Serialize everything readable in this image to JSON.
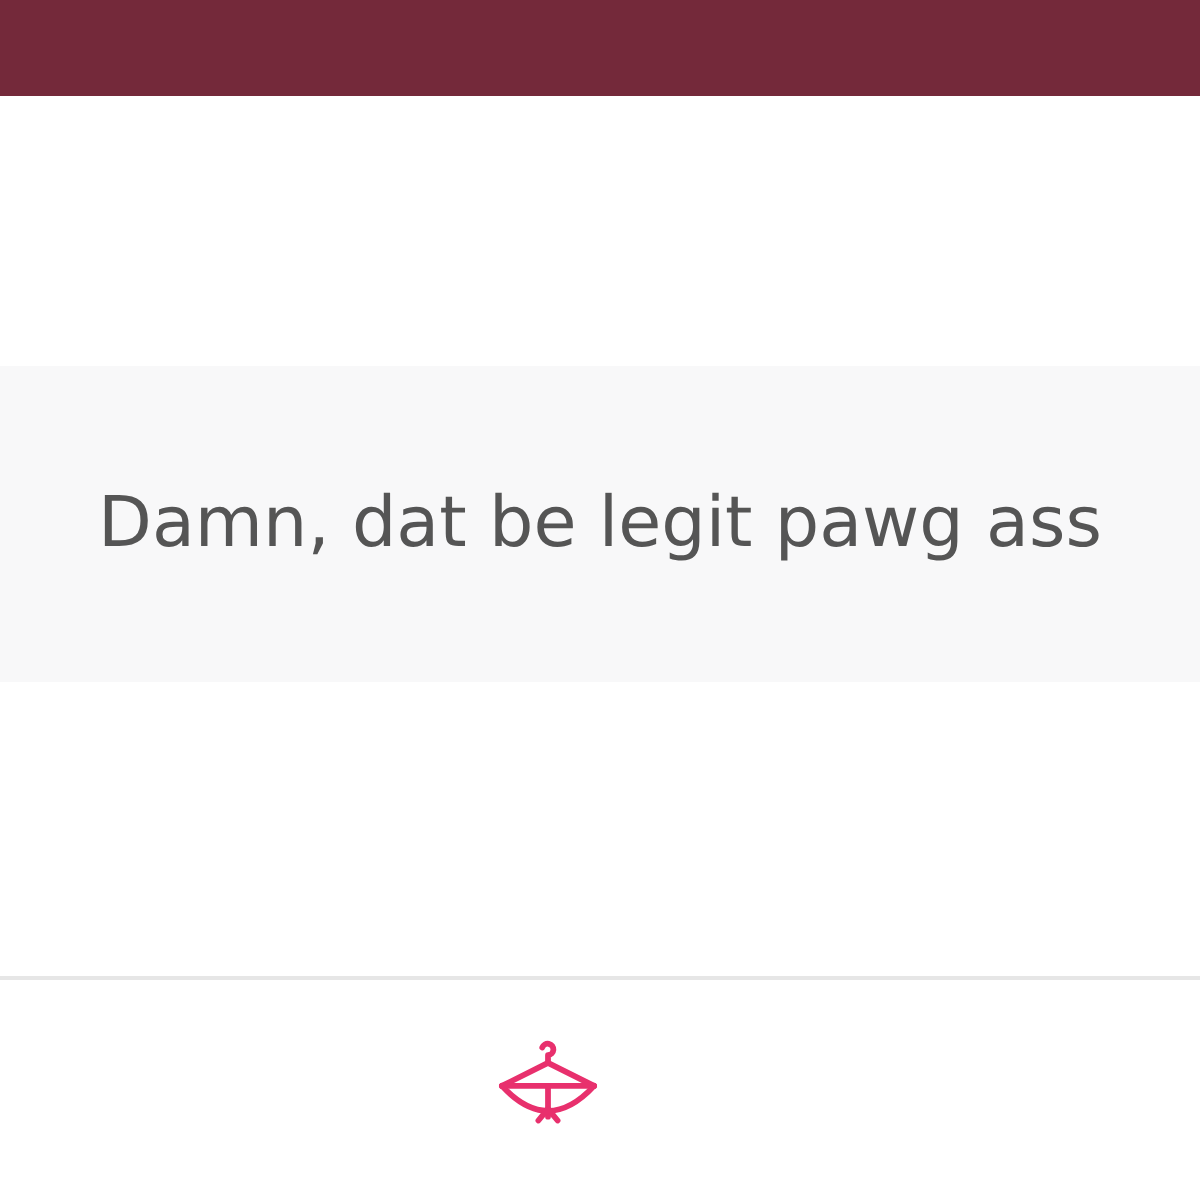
{
  "comment": {
    "text": "Damn, dat be legit pawg ass"
  }
}
